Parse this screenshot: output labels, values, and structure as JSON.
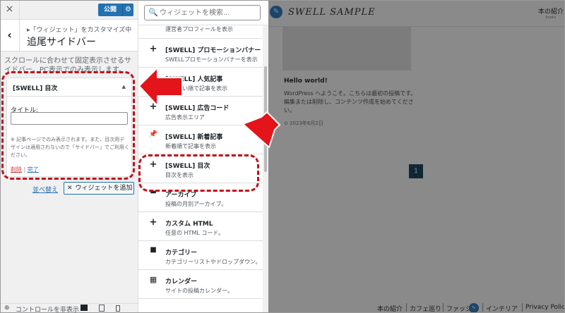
{
  "customizer": {
    "close_icon": "×",
    "publish_label": "公開",
    "publish_gear_icon": "⚙",
    "back_icon": "‹",
    "breadcrumb": "▸「ウィジェット」をカスタマイズ中",
    "panel_title": "追尾サイドバー",
    "description": "スクロールに合わせて固定表示させるサイドバー。PC表示でのみ表示します。",
    "widget": {
      "name": "[SWELL] 目次",
      "toggle_icon": "▲",
      "title_label": "タイトル:",
      "title_value": "",
      "note": "※ 記事ページでのみ表示されます。また、目次用デザインは適用されないので「サイドバー」でご利用ください。",
      "delete_label": "削除",
      "separator": "|",
      "done_label": "完了"
    },
    "reorder_label": "並べ替え",
    "add_widget_icon": "✕",
    "add_widget_label": "ウィジェットを追加",
    "footer": {
      "hide_controls_icon": "⊕",
      "hide_controls_label": "コントロールを非表示"
    }
  },
  "picker": {
    "search_icon": "🔍",
    "search_placeholder": "ウィジェットを検索...",
    "partial_desc": "運営者プロフィールを表示",
    "items": [
      {
        "icon": "+",
        "name": "[SWELL] プロモーションバナー",
        "desc": "SWELLプロモーションバナーを表示"
      },
      {
        "icon": "+",
        "name": "[SWELL] 人気記事",
        "desc": "人気順い順で記事を表示"
      },
      {
        "icon": "+",
        "name": "[SWELL] 広告コード",
        "desc": "広告表示エリア"
      },
      {
        "icon": "📌",
        "name": "[SWELL] 新着記事",
        "desc": "新着順で記事を表示"
      },
      {
        "icon": "+",
        "name": "[SWELL] 目次",
        "desc": "目次を表示"
      },
      {
        "icon": "▬",
        "name": "アーカイブ",
        "desc": "投稿の月別アーカイブ。"
      },
      {
        "icon": "+",
        "name": "カスタム HTML",
        "desc": "任意の HTML コード。"
      },
      {
        "icon": "■",
        "name": "カテゴリー",
        "desc": "カテゴリーリストやドロップダウン。"
      },
      {
        "icon": "▦",
        "name": "カレンダー",
        "desc": "サイトの投稿カレンダー。"
      }
    ]
  },
  "preview": {
    "edit_icon": "✎",
    "site_title": "SWELL SAMPLE",
    "nav_label": "本の紹介",
    "nav_sub": "books",
    "post_title": "Hello world!",
    "post_excerpt": "WordPress へようこそ。こちらは最初の投稿です。編集または削除し、コンテンツ作成を始めてください。",
    "post_date": "⊙ 2023年6月2日",
    "page_number": "1",
    "footer_links": [
      "本の紹介",
      "カフェ巡り",
      "ファッシ",
      "インテリア",
      "Privacy Policy"
    ]
  },
  "colors": {
    "accent": "#2271b1",
    "annotation": "#e3141a",
    "page_current_bg": "#1f4a63"
  }
}
